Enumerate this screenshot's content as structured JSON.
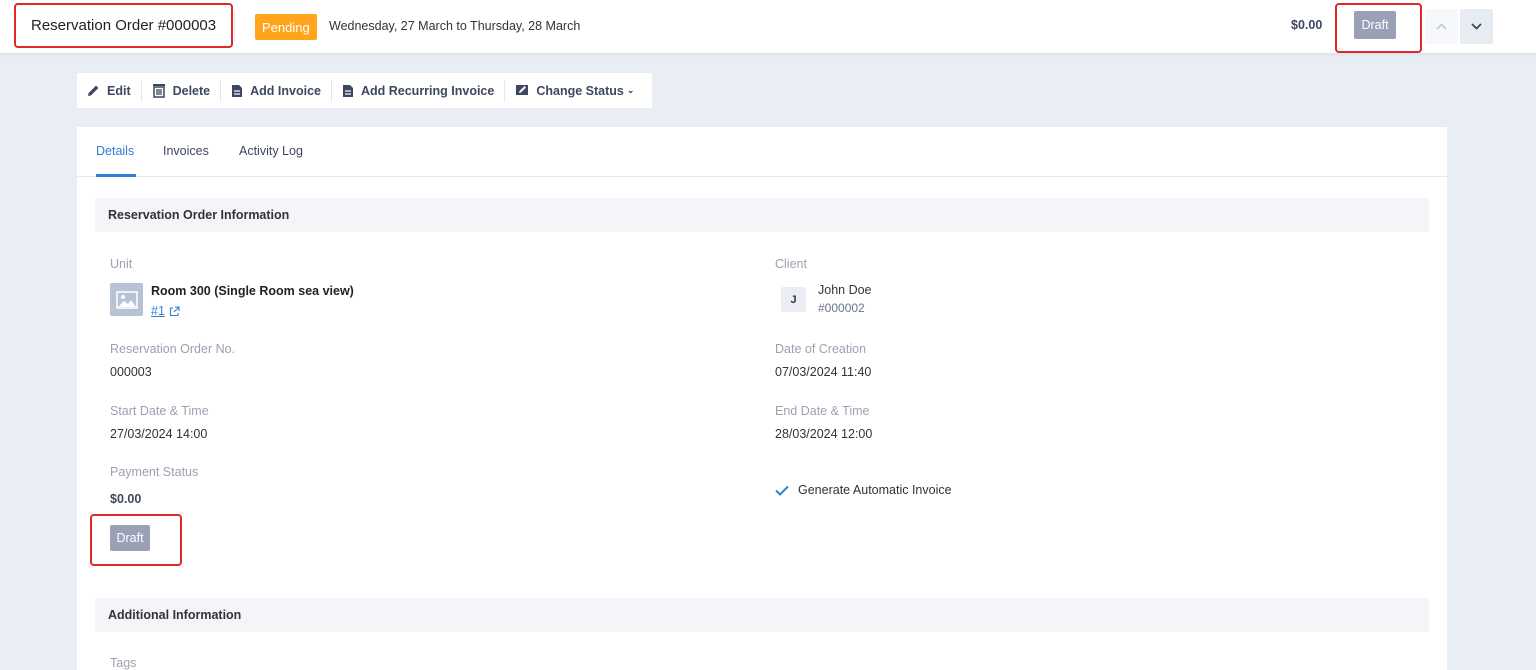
{
  "header": {
    "order_title": "Reservation Order #000003",
    "status_badge": "Pending",
    "date_range": "Wednesday, 27 March to Thursday, 28 March",
    "amount": "$0.00",
    "draft_badge": "Draft"
  },
  "toolbar": {
    "edit": "Edit",
    "delete": "Delete",
    "add_invoice": "Add Invoice",
    "add_recurring_invoice": "Add Recurring Invoice",
    "change_status": "Change Status"
  },
  "tabs": [
    {
      "label": "Details",
      "active": true
    },
    {
      "label": "Invoices",
      "active": false
    },
    {
      "label": "Activity Log",
      "active": false
    }
  ],
  "sections": {
    "info_title": "Reservation Order Information",
    "additional_title": "Additional Information"
  },
  "fields": {
    "unit_label": "Unit",
    "unit_name": "Room 300 (Single Room sea view)",
    "unit_link": "#1",
    "client_label": "Client",
    "client_initial": "J",
    "client_name": "John Doe",
    "client_id": "#000002",
    "order_no_label": "Reservation Order No.",
    "order_no": "000003",
    "created_label": "Date of Creation",
    "created": "07/03/2024 11:40",
    "start_label": "Start Date & Time",
    "start": "27/03/2024 14:00",
    "end_label": "End Date & Time",
    "end": "28/03/2024 12:00",
    "payment_label": "Payment Status",
    "payment_amount": "$0.00",
    "payment_badge": "Draft",
    "auto_invoice": "Generate Automatic Invoice",
    "tags_label": "Tags"
  },
  "colors": {
    "accent": "#2f7fd6",
    "pending": "#ffa41b",
    "draft": "#9aa0b6",
    "highlight": "#e02828"
  }
}
